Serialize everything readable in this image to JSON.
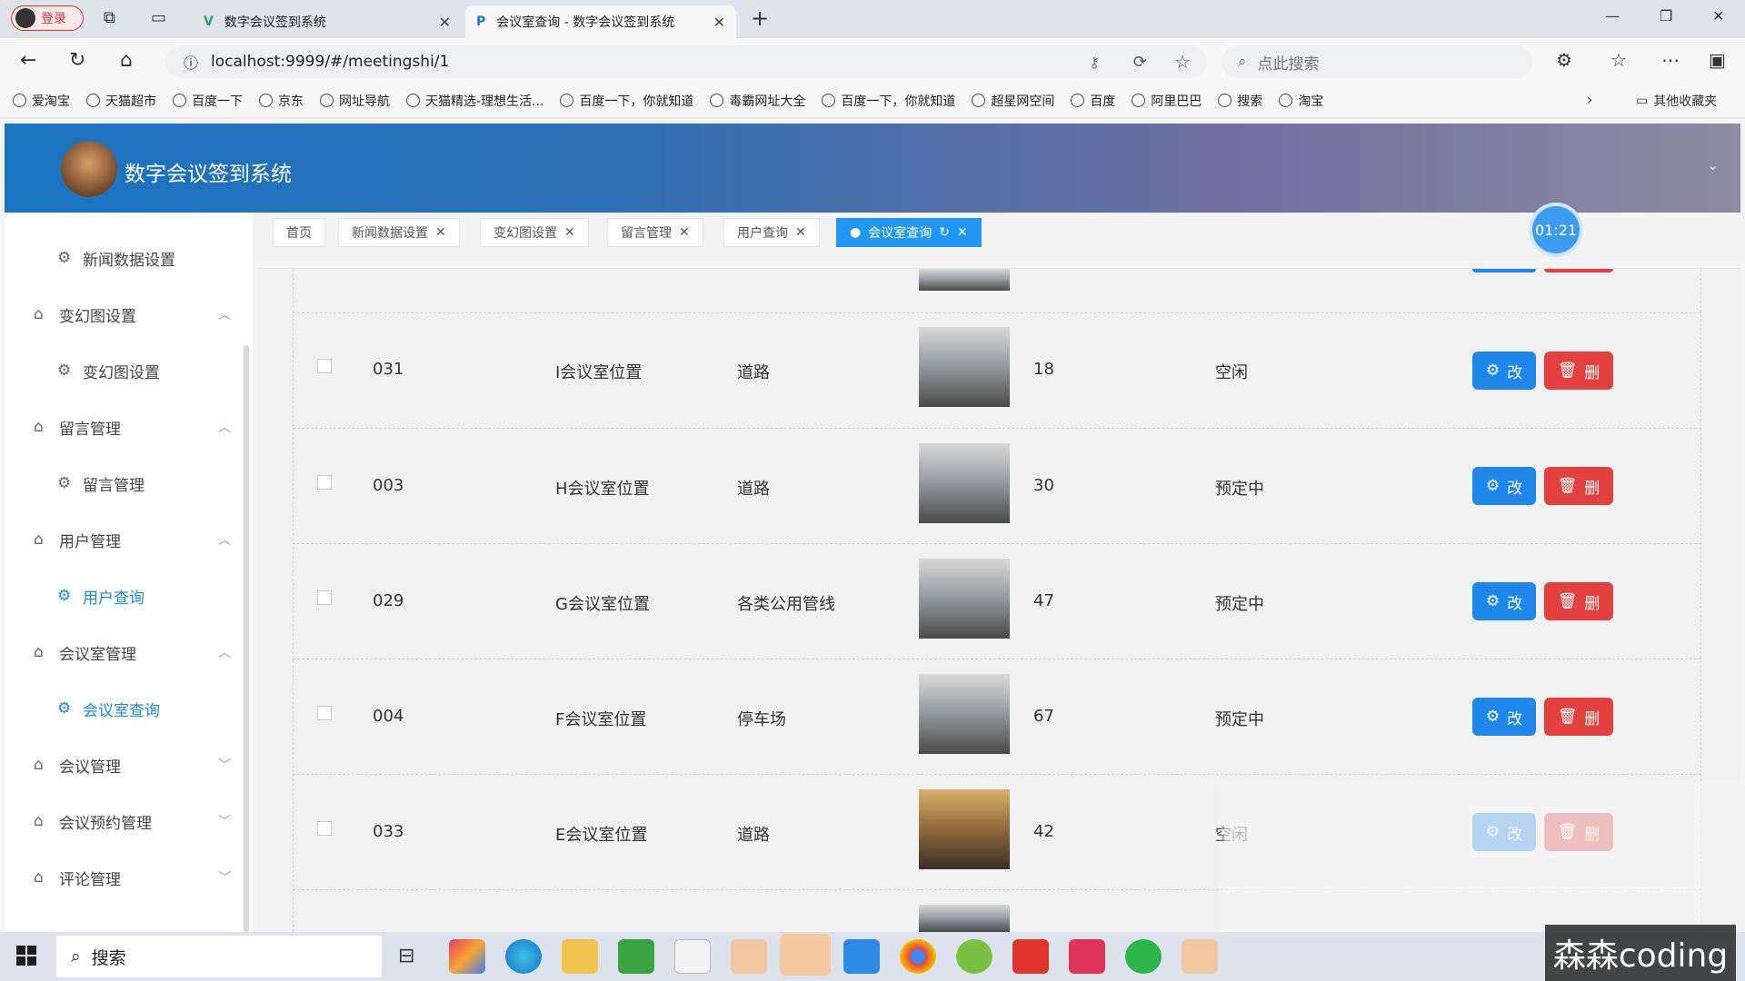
{
  "browser": {
    "login_badge": "登录",
    "tabs": [
      {
        "title": "数字会议签到系统"
      },
      {
        "title": "会议室查询 - 数字会议签到系统"
      }
    ],
    "url": "localhost:9999/#/meetingshi/1",
    "search_placeholder": "点此搜索",
    "bookmarks": [
      "爱淘宝",
      "天猫超市",
      "百度一下",
      "京东",
      "网址导航",
      "天猫精选-理想生活...",
      "百度一下，你就知道",
      "毒霸网址大全",
      "百度一下，你就知道",
      "超星网空间",
      "百度",
      "阿里巴巴",
      "搜索",
      "淘宝"
    ],
    "other_bookmarks": "其他收藏夹"
  },
  "app": {
    "title": "数字会议签到系统",
    "timer": "01:21"
  },
  "sidebar": {
    "items": [
      {
        "label": "新闻数据设置",
        "type": "sub"
      },
      {
        "label": "变幻图设置",
        "type": "group",
        "expanded": true
      },
      {
        "label": "变幻图设置",
        "type": "sub"
      },
      {
        "label": "留言管理",
        "type": "group",
        "expanded": true
      },
      {
        "label": "留言管理",
        "type": "sub"
      },
      {
        "label": "用户管理",
        "type": "group",
        "expanded": true
      },
      {
        "label": "用户查询",
        "type": "sub",
        "selected": true
      },
      {
        "label": "会议室管理",
        "type": "group",
        "expanded": true
      },
      {
        "label": "会议室查询",
        "type": "sub",
        "selected": true
      },
      {
        "label": "会议管理",
        "type": "group",
        "expanded": false
      },
      {
        "label": "会议预约管理",
        "type": "group",
        "expanded": false
      },
      {
        "label": "评论管理",
        "type": "group",
        "expanded": false
      }
    ]
  },
  "tags": [
    "首页",
    "新闻数据设置",
    "变幻图设置",
    "留言管理",
    "用户查询",
    "会议室查询"
  ],
  "table": {
    "rows": [
      {
        "id": "031",
        "name": "I会议室位置",
        "facility": "道路",
        "capacity": "18",
        "status": "空闲"
      },
      {
        "id": "003",
        "name": "H会议室位置",
        "facility": "道路",
        "capacity": "30",
        "status": "预定中"
      },
      {
        "id": "029",
        "name": "G会议室位置",
        "facility": "各类公用管线",
        "capacity": "47",
        "status": "预定中"
      },
      {
        "id": "004",
        "name": "F会议室位置",
        "facility": "停车场",
        "capacity": "67",
        "status": "预定中"
      },
      {
        "id": "033",
        "name": "E会议室位置",
        "facility": "道路",
        "capacity": "42",
        "status": "空闲"
      }
    ],
    "edit_label": "改",
    "delete_label": "删"
  },
  "taskbar": {
    "search": "搜索",
    "watermark": "森森coding"
  }
}
